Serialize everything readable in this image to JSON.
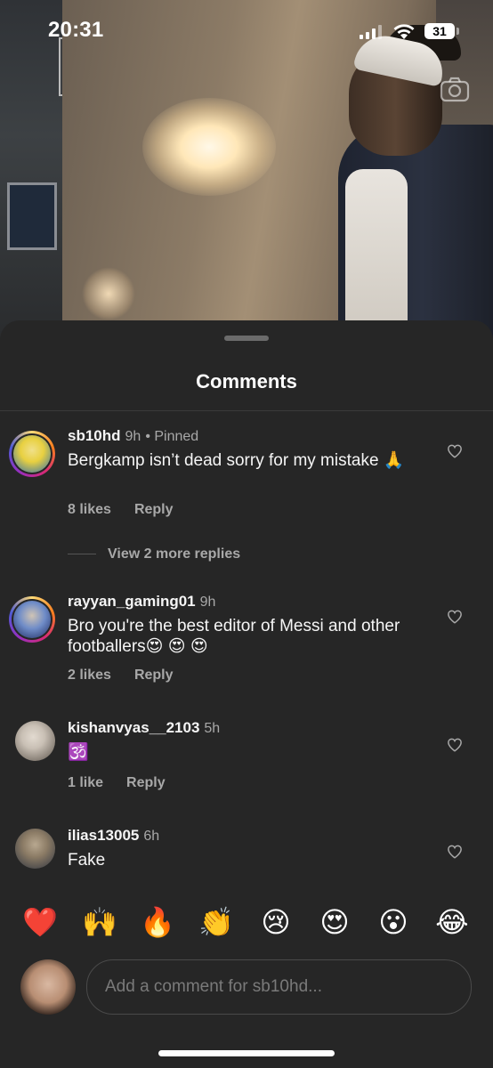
{
  "status_bar": {
    "time": "20:31",
    "battery": "31"
  },
  "sheet": {
    "title": "Comments"
  },
  "comments": [
    {
      "username": "sb10hd",
      "time": "9h",
      "pinned": "• Pinned",
      "text": "Bergkamp isn’t dead sorry for my mistake 🙏",
      "likes": "8 likes",
      "reply": "Reply",
      "avatar_ring": true,
      "avatar_colors": [
        "#e8d040",
        "#2b6db0"
      ]
    },
    {
      "username": "rayyan_gaming01",
      "time": "9h",
      "pinned": "",
      "text": "Bro you're the best editor of Messi and other footballers😍 😍 😍",
      "likes": "2 likes",
      "reply": "Reply",
      "avatar_ring": true,
      "avatar_colors": [
        "#1e2a60",
        "#6f8cc8"
      ]
    },
    {
      "username": "kishanvyas__2103",
      "time": "5h",
      "pinned": "",
      "text": "🕉️",
      "likes": "1 like",
      "reply": "Reply",
      "avatar_ring": false,
      "avatar_colors": [
        "#c9c0b5",
        "#5a524a"
      ]
    },
    {
      "username": "ilias13005",
      "time": "6h",
      "pinned": "",
      "text": "Fake",
      "likes": "",
      "reply": "",
      "avatar_ring": false,
      "avatar_colors": [
        "#8b7b65",
        "#2e3440"
      ]
    }
  ],
  "view_more_replies": "View 2 more replies",
  "quick_reactions": [
    {
      "emoji": "❤️",
      "name": "heart-emoji"
    },
    {
      "emoji": "🙌",
      "name": "raising-hands-emoji"
    },
    {
      "emoji": "🔥",
      "name": "fire-emoji"
    },
    {
      "emoji": "👏",
      "name": "clapping-emoji"
    },
    {
      "emoji": "😢",
      "name": "crying-emoji"
    },
    {
      "emoji": "😍",
      "name": "heart-eyes-emoji"
    },
    {
      "emoji": "😮",
      "name": "surprised-emoji"
    },
    {
      "emoji": "😂",
      "name": "laughing-emoji"
    }
  ],
  "comment_input": {
    "placeholder": "Add a comment for sb10hd..."
  },
  "colors": {
    "sheet_bg": "#262626",
    "secondary_text": "#a8a8a8"
  },
  "icons": [
    "camera-icon",
    "heart-icon",
    "signal-icon",
    "wifi-icon",
    "battery-icon"
  ]
}
